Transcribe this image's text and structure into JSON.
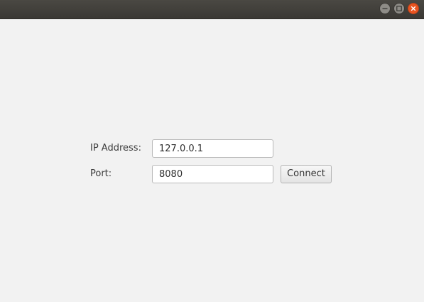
{
  "window": {
    "controls": [
      "minimize-icon",
      "maximize-icon",
      "close-icon"
    ],
    "close_color": "#e95420"
  },
  "form": {
    "ip_label": "IP Address:",
    "ip_value": "127.0.0.1",
    "port_label": "Port:",
    "port_value": "8080",
    "connect_label": "Connect"
  }
}
